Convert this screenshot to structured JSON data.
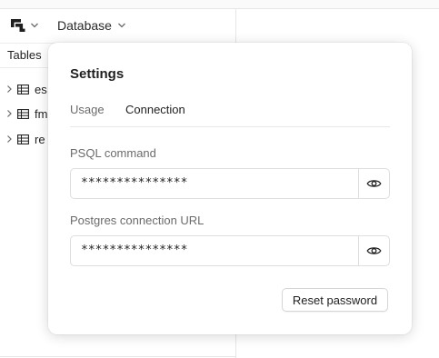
{
  "toolbar": {
    "logo_icon": "app-logo-icon",
    "database_label": "Database"
  },
  "sidebar": {
    "tab_label": "Tables",
    "items": [
      {
        "label": "es"
      },
      {
        "label": "fm"
      },
      {
        "label": "re"
      }
    ]
  },
  "modal": {
    "title": "Settings",
    "tabs": [
      {
        "label": "Usage",
        "active": false
      },
      {
        "label": "Connection",
        "active": true
      }
    ],
    "fields": [
      {
        "label": "PSQL command",
        "value": "***************"
      },
      {
        "label": "Postgres connection URL",
        "value": "***************"
      }
    ],
    "reset_label": "Reset password"
  }
}
